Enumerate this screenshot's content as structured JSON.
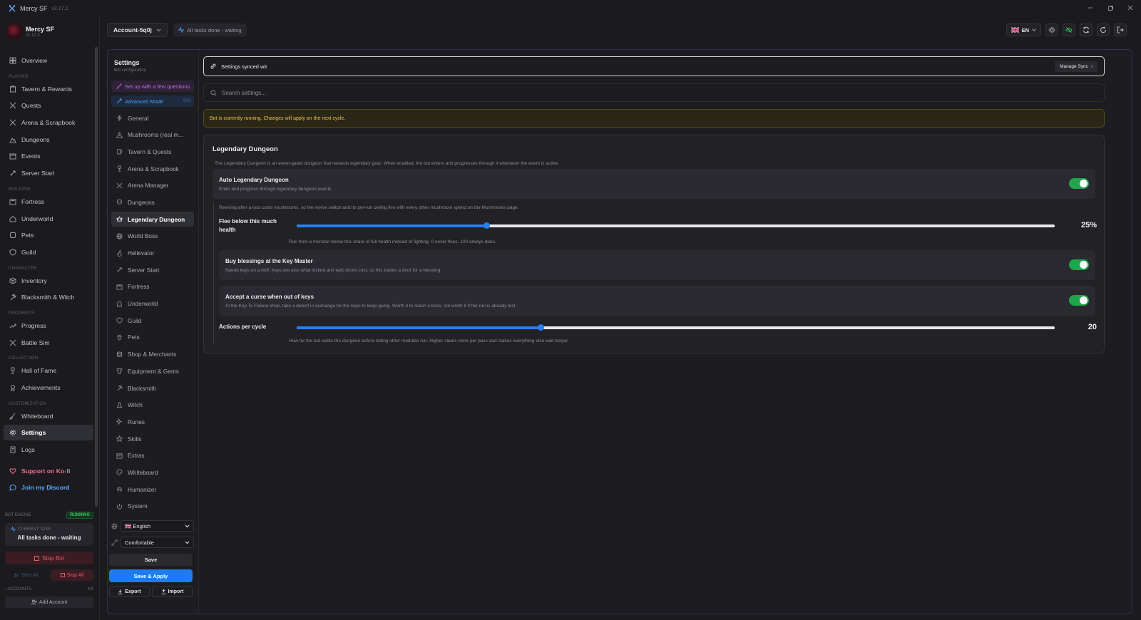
{
  "window": {
    "title": "Mercy SF",
    "version": "v2.17.2"
  },
  "brand": {
    "name": "Mercy SF",
    "version": "v2.17.2"
  },
  "sidebar": {
    "overview": "Overview",
    "sections": {
      "playing": "PLAYING",
      "building": "BUILDING",
      "character": "CHARACTER",
      "progress": "PROGRESS",
      "collection": "COLLECTION",
      "customization": "CUSTOMIZATION"
    },
    "playing": [
      "Tavern & Rewards",
      "Quests",
      "Arena & Scrapbook",
      "Dungeons",
      "Events",
      "Server Start"
    ],
    "building": [
      "Fortress",
      "Underworld",
      "Pets",
      "Guild"
    ],
    "character": [
      "Inventory",
      "Blacksmith & Witch"
    ],
    "progress": [
      "Progress",
      "Battle Sim"
    ],
    "collection": [
      "Hall of Fame",
      "Achievements"
    ],
    "customization": [
      "Whiteboard",
      "Settings",
      "Logs"
    ],
    "support": "Support on Ko-fi",
    "discord": "Join my Discord"
  },
  "engine": {
    "label": "BOT ENGINE",
    "status": "RUNNING",
    "current_task_label": "CURRENT TASK",
    "current_task": "All tasks done - waiting",
    "stop_bot": "Stop Bot",
    "start_all": "Start All",
    "stop_all": "Stop All",
    "accounts_label": "ACCOUNTS",
    "accounts_count": "4/4",
    "add_account": "Add Account"
  },
  "topbar": {
    "account": "Account-5q0j",
    "task_status": "All tasks done - waiting",
    "language": "EN"
  },
  "settings_panel": {
    "title": "Settings",
    "subtitle": "Bot configuration",
    "wizard": "Set up with a few questions",
    "advanced": "Advanced Mode",
    "advanced_state": "ON",
    "items": [
      "General",
      "Mushrooms (real m...",
      "Tavern & Quests",
      "Arena & Scrapbook",
      "Arena Manager",
      "Dungeons",
      "Legendary Dungeon",
      "World Boss",
      "Hellevator",
      "Server Start",
      "Fortress",
      "Underworld",
      "Guild",
      "Pets",
      "Shop & Merchants",
      "Equipment & Gems",
      "Blacksmith",
      "Witch",
      "Runes",
      "Skills",
      "Extras",
      "Whiteboard",
      "Humanizer",
      "System"
    ],
    "active_item": "Legendary Dungeon",
    "language_select": "🇬🇧 English",
    "density_select": "Comfortable",
    "save": "Save",
    "save_apply": "Save & Apply",
    "export": "Export",
    "import": "Import"
  },
  "main": {
    "sync_text": "Settings synced wit",
    "manage_sync": "Manage Sync",
    "search_placeholder": "Search settings...",
    "warning": "Bot is currently running. Changes will apply on the next cycle.",
    "card": {
      "title": "Legendary Dungeon",
      "description": "The Legendary Dungeon is an event-gated dungeon that rewards legendary gear. When enabled, the bot enters and progresses through it whenever the event is active.",
      "auto": {
        "title": "Auto Legendary Dungeon",
        "desc": "Enter and progress through legendary dungeon events",
        "enabled": true
      },
      "note": "Reviving after a loss costs mushrooms, so the revive switch and its per-run ceiling live with every other mushroom spend on the Mushrooms page.",
      "flee": {
        "label": "Flee below this much health",
        "value_text": "25%",
        "value": 25,
        "min": 0,
        "max": 100,
        "help": "Run from a monster below this share of full health instead of fighting. 0 never flees; 100 always does."
      },
      "blessings": {
        "title": "Buy blessings at the Key Master",
        "desc": "Spend keys on a buff. Keys are also what locked and epic doors cost, so this trades a door for a blessing.",
        "enabled": true
      },
      "curse": {
        "title": "Accept a curse when out of keys",
        "desc": "At the Key To Failure shop, take a debuff in exchange for the keys to keep going. Worth it to reach a boss, not worth it if the run is already lost.",
        "enabled": true
      },
      "actions": {
        "label": "Actions per cycle",
        "value_text": "20",
        "value": 20,
        "min": 1,
        "max": 60,
        "help": "How far the bot walks the dungeon before letting other modules run. Higher clears more per pass and makes everything else wait longer."
      }
    }
  },
  "colors": {
    "accent": "#1e7bf0",
    "toggle_on": "#1fa64c",
    "warning": "#e6c14a",
    "danger": "#e25d6e",
    "running": "#37c364"
  }
}
